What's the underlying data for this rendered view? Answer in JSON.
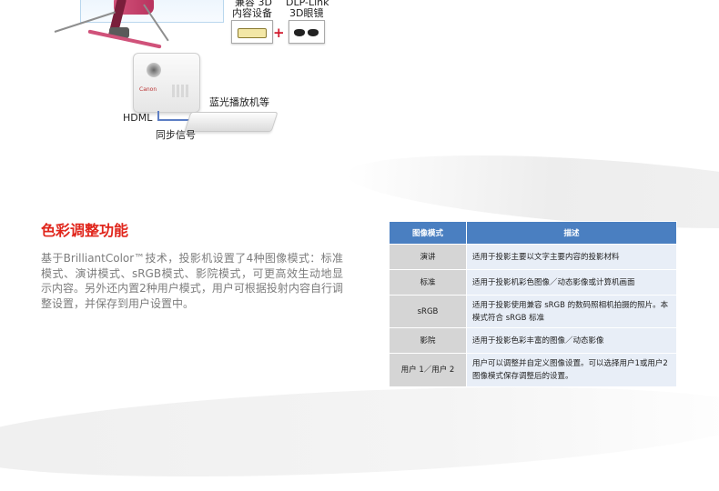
{
  "illustration": {
    "device_labels": {
      "compatible_3d_line1": "兼容 3D",
      "compatible_3d_line2": "内容设备",
      "dlp_link_line1": "DLP-Link",
      "dlp_link_line2": "3D眼镜",
      "bluray": "蓝光播放机等",
      "hdmi": "HDML",
      "sync": "同步信号"
    },
    "plus_sign": "+",
    "projector_logo": "Canon"
  },
  "section": {
    "title": "色彩调整功能",
    "body": "基于BrilliantColor™技术，投影机设置了4种图像模式：标准模式、演讲模式、sRGB模式、影院模式，可更高效生动地显示内容。另外还内置2种用户模式，用户可根据投射内容自行调整设置，并保存到用户设置中。"
  },
  "table": {
    "headers": {
      "mode": "图像模式",
      "desc": "描述"
    },
    "rows": [
      {
        "mode": "演讲",
        "desc": "适用于投影主要以文字主要内容的投影材料"
      },
      {
        "mode": "标准",
        "desc": "适用于投影机彩色图像／动态影像或计算机画面"
      },
      {
        "mode": "sRGB",
        "desc": "适用于投影使用兼容 sRGB 的数码照相机拍摄的照片。本模式符合 sRGB 标准"
      },
      {
        "mode": "影院",
        "desc": "适用于投影色彩丰富的图像／动态影像"
      },
      {
        "mode": "用户 1／用户 2",
        "desc": "用户可以调整并自定义图像设置。可以选择用户1或用户2图像模式保存调整后的设置。"
      }
    ]
  },
  "colors": {
    "title_red": "#e0261c",
    "header_blue": "#4a7fc1",
    "mode_cell_grey": "#d5d5d5",
    "desc_cell_blue": "#e8eef7",
    "body_text_grey": "#7d7d7d"
  }
}
